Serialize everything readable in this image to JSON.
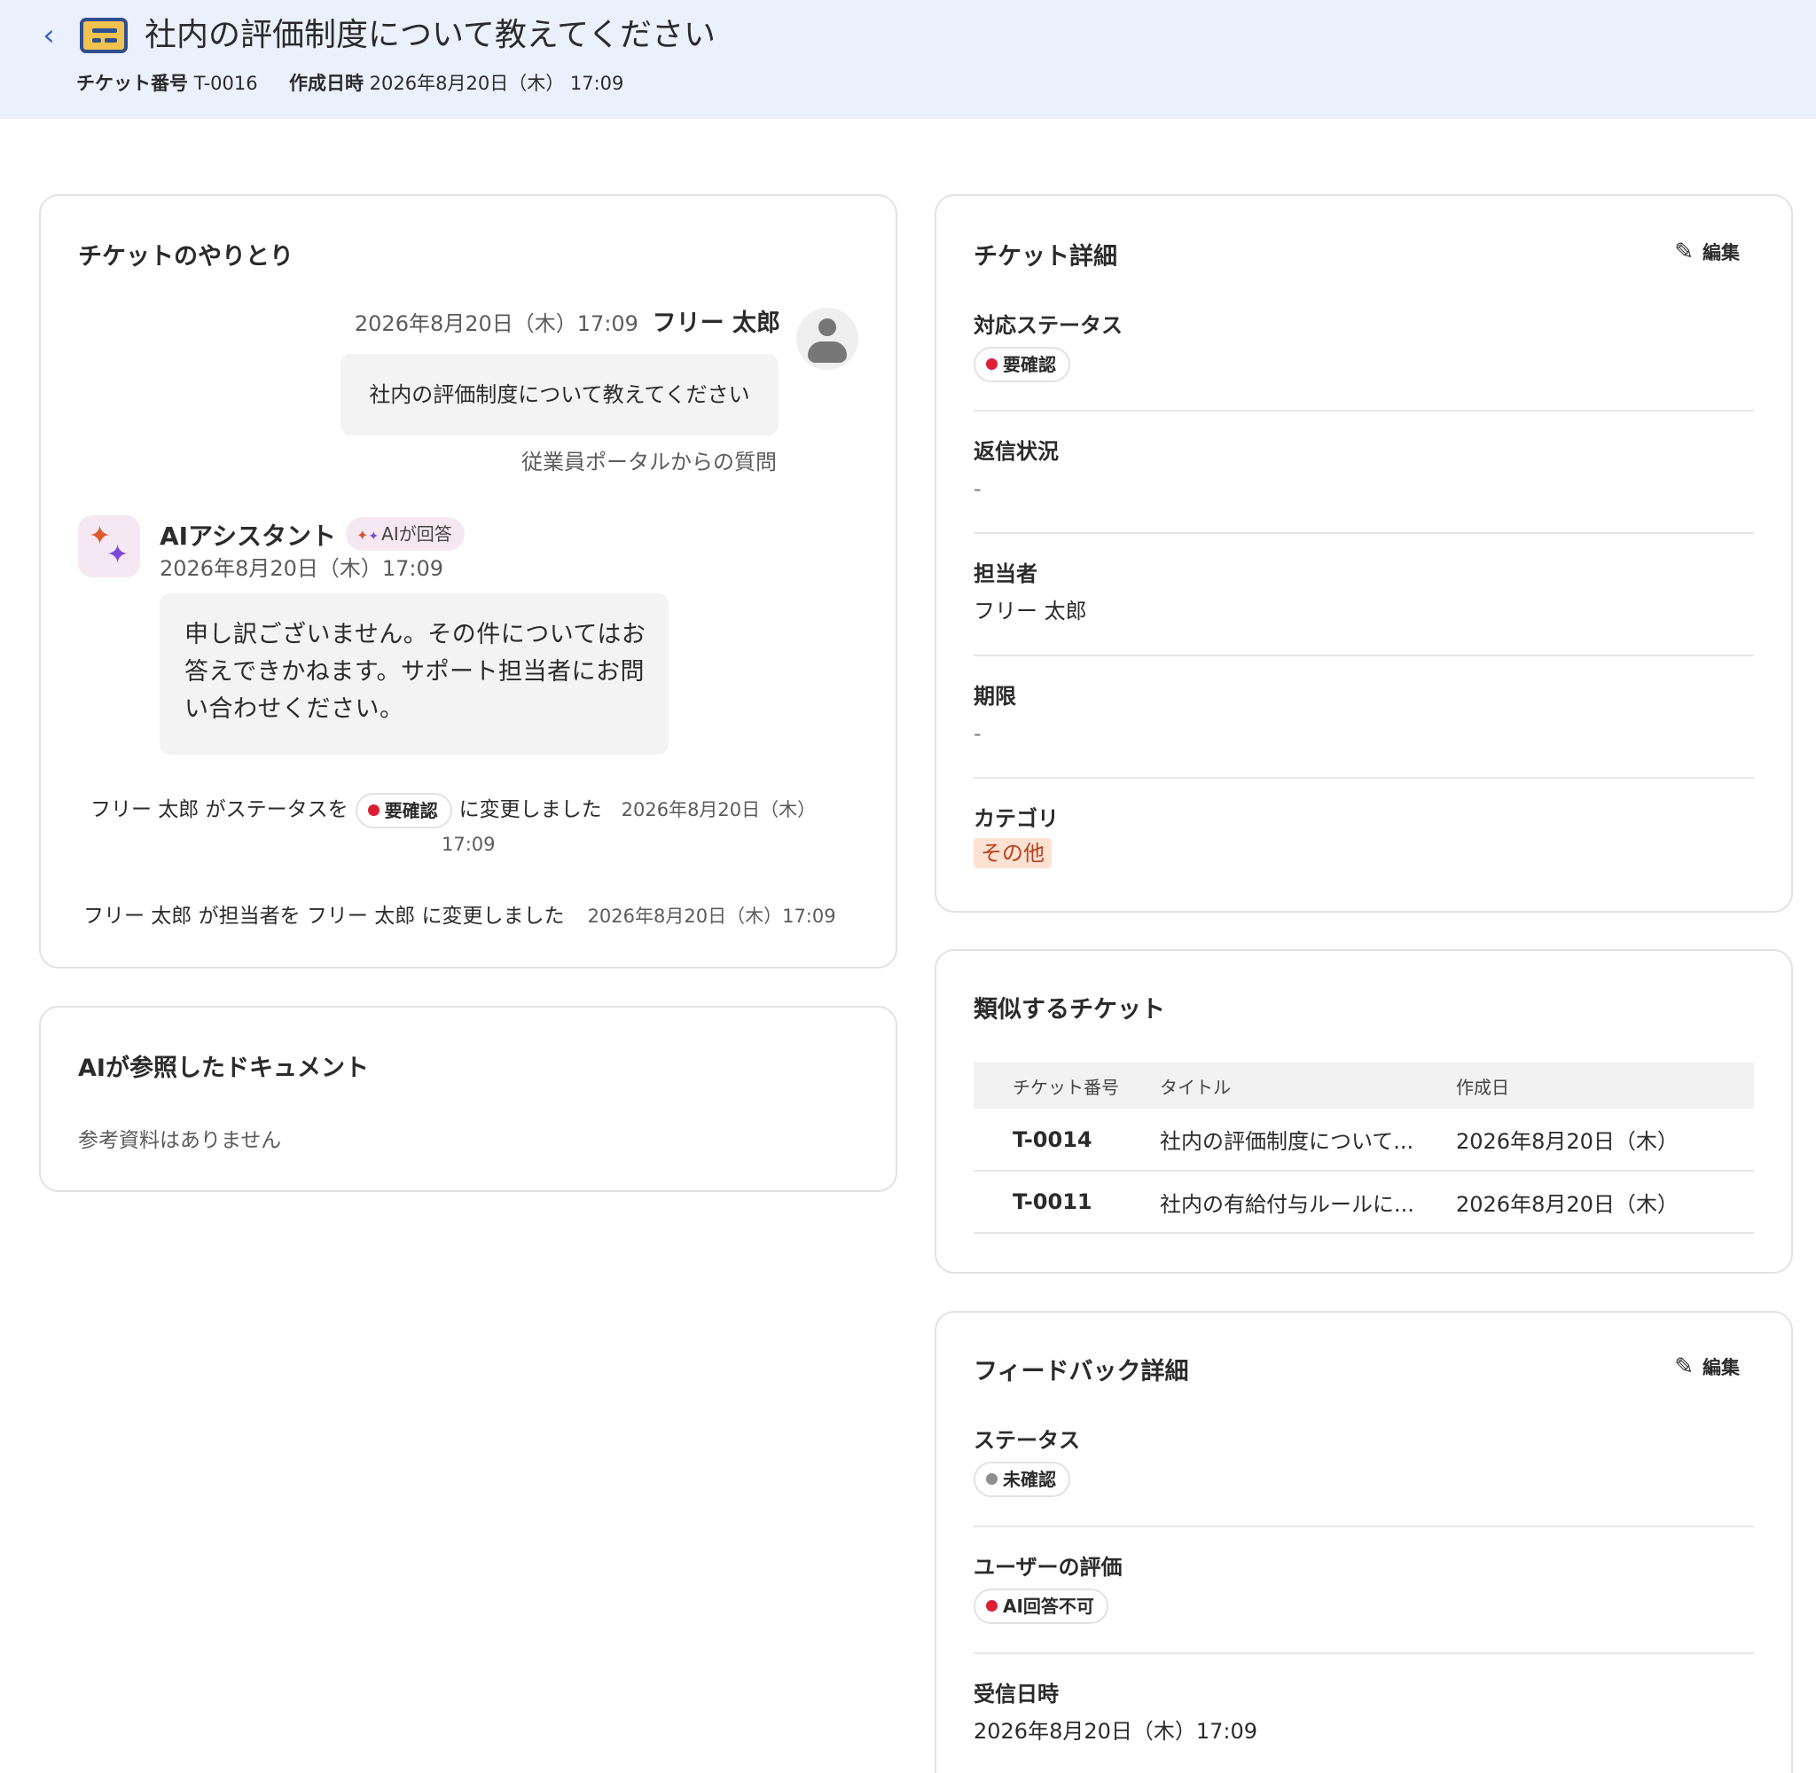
{
  "header": {
    "title": "社内の評価制度について教えてください",
    "ticket_no_label": "チケット番号",
    "ticket_no": "T-0016",
    "created_label": "作成日時",
    "created_at": "2026年8月20日（木） 17:09",
    "back_icon": "chevron-left-icon",
    "ticket_icon": "ticket-card-icon"
  },
  "conversation": {
    "title": "チケットのやりとり",
    "user_message": {
      "time": "2026年8月20日（木）17:09",
      "name": "フリー 太郎",
      "text": "社内の評価制度について教えてください",
      "source": "従業員ポータルからの質問"
    },
    "ai_message": {
      "name": "AIアシスタント",
      "badge": "AIが回答",
      "time": "2026年8月20日（木）17:09",
      "text": "申し訳ございません。その件についてはお答えできかねます。サポート担当者にお問い合わせください。"
    },
    "log1": {
      "prefix": "フリー 太郎 がステータスを",
      "status": "要確認",
      "suffix": "に変更しました",
      "time_date": "2026年8月20日（木）",
      "time_clock": "17:09"
    },
    "log2": {
      "text": "フリー 太郎 が担当者を フリー 太郎 に変更しました",
      "time": "2026年8月20日（木）17:09"
    }
  },
  "docs": {
    "title": "AIが参照したドキュメント",
    "empty": "参考資料はありません"
  },
  "details": {
    "title": "チケット詳細",
    "edit_label": "編集",
    "status_label": "対応ステータス",
    "status_value": "要確認",
    "reply_label": "返信状況",
    "reply_value": "-",
    "assignee_label": "担当者",
    "assignee_value": "フリー 太郎",
    "deadline_label": "期限",
    "deadline_value": "-",
    "category_label": "カテゴリ",
    "category_value": "その他"
  },
  "similar": {
    "title": "類似するチケット",
    "columns": [
      "チケット番号",
      "タイトル",
      "作成日"
    ],
    "rows": [
      {
        "no": "T-0014",
        "title": "社内の評価制度について...",
        "date": "2026年8月20日（木）"
      },
      {
        "no": "T-0011",
        "title": "社内の有給付与ルールに...",
        "date": "2026年8月20日（木）"
      }
    ]
  },
  "feedback": {
    "title": "フィードバック詳細",
    "edit_label": "編集",
    "status_label": "ステータス",
    "status_value": "未確認",
    "rating_label": "ユーザーの評価",
    "rating_value": "AI回答不可",
    "received_label": "受信日時",
    "received_value": "2026年8月20日（木）17:09"
  },
  "colors": {
    "header_bg": "#ebf1fc",
    "status_red": "#dc1f37",
    "status_gray": "#8e8e8e",
    "category_bg": "#fde2d4",
    "category_text": "#b7401c",
    "ai_badge_bg": "#f6e8f2"
  }
}
